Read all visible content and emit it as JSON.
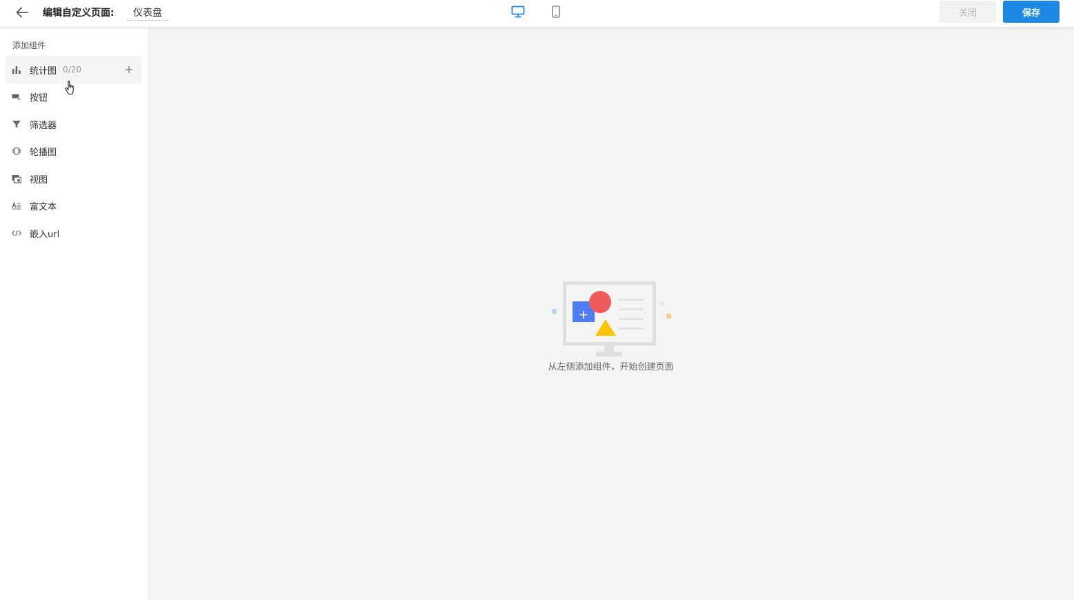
{
  "header": {
    "title_label": "编辑自定义页面:",
    "page_name": "仪表盘",
    "close_label": "关闭",
    "save_label": "保存"
  },
  "sidebar": {
    "title": "添加组件",
    "items": [
      {
        "label": "统计图",
        "count": "0/20",
        "icon": "bar-chart-icon"
      },
      {
        "label": "按钮",
        "icon": "button-icon"
      },
      {
        "label": "筛选器",
        "icon": "filter-icon"
      },
      {
        "label": "轮播图",
        "icon": "carousel-icon"
      },
      {
        "label": "视图",
        "icon": "view-icon"
      },
      {
        "label": "富文本",
        "icon": "rich-text-icon"
      },
      {
        "label": "嵌入url",
        "icon": "embed-code-icon"
      }
    ]
  },
  "canvas": {
    "empty_text": "从左侧添加组件，开始创建页面"
  },
  "colors": {
    "primary": "#1e88e5",
    "canvas_bg": "#f4f4f3",
    "icon_gray": "#666666",
    "illus_red": "#f05a5a",
    "illus_blue": "#4d7cf4",
    "illus_yellow": "#ffc400"
  }
}
